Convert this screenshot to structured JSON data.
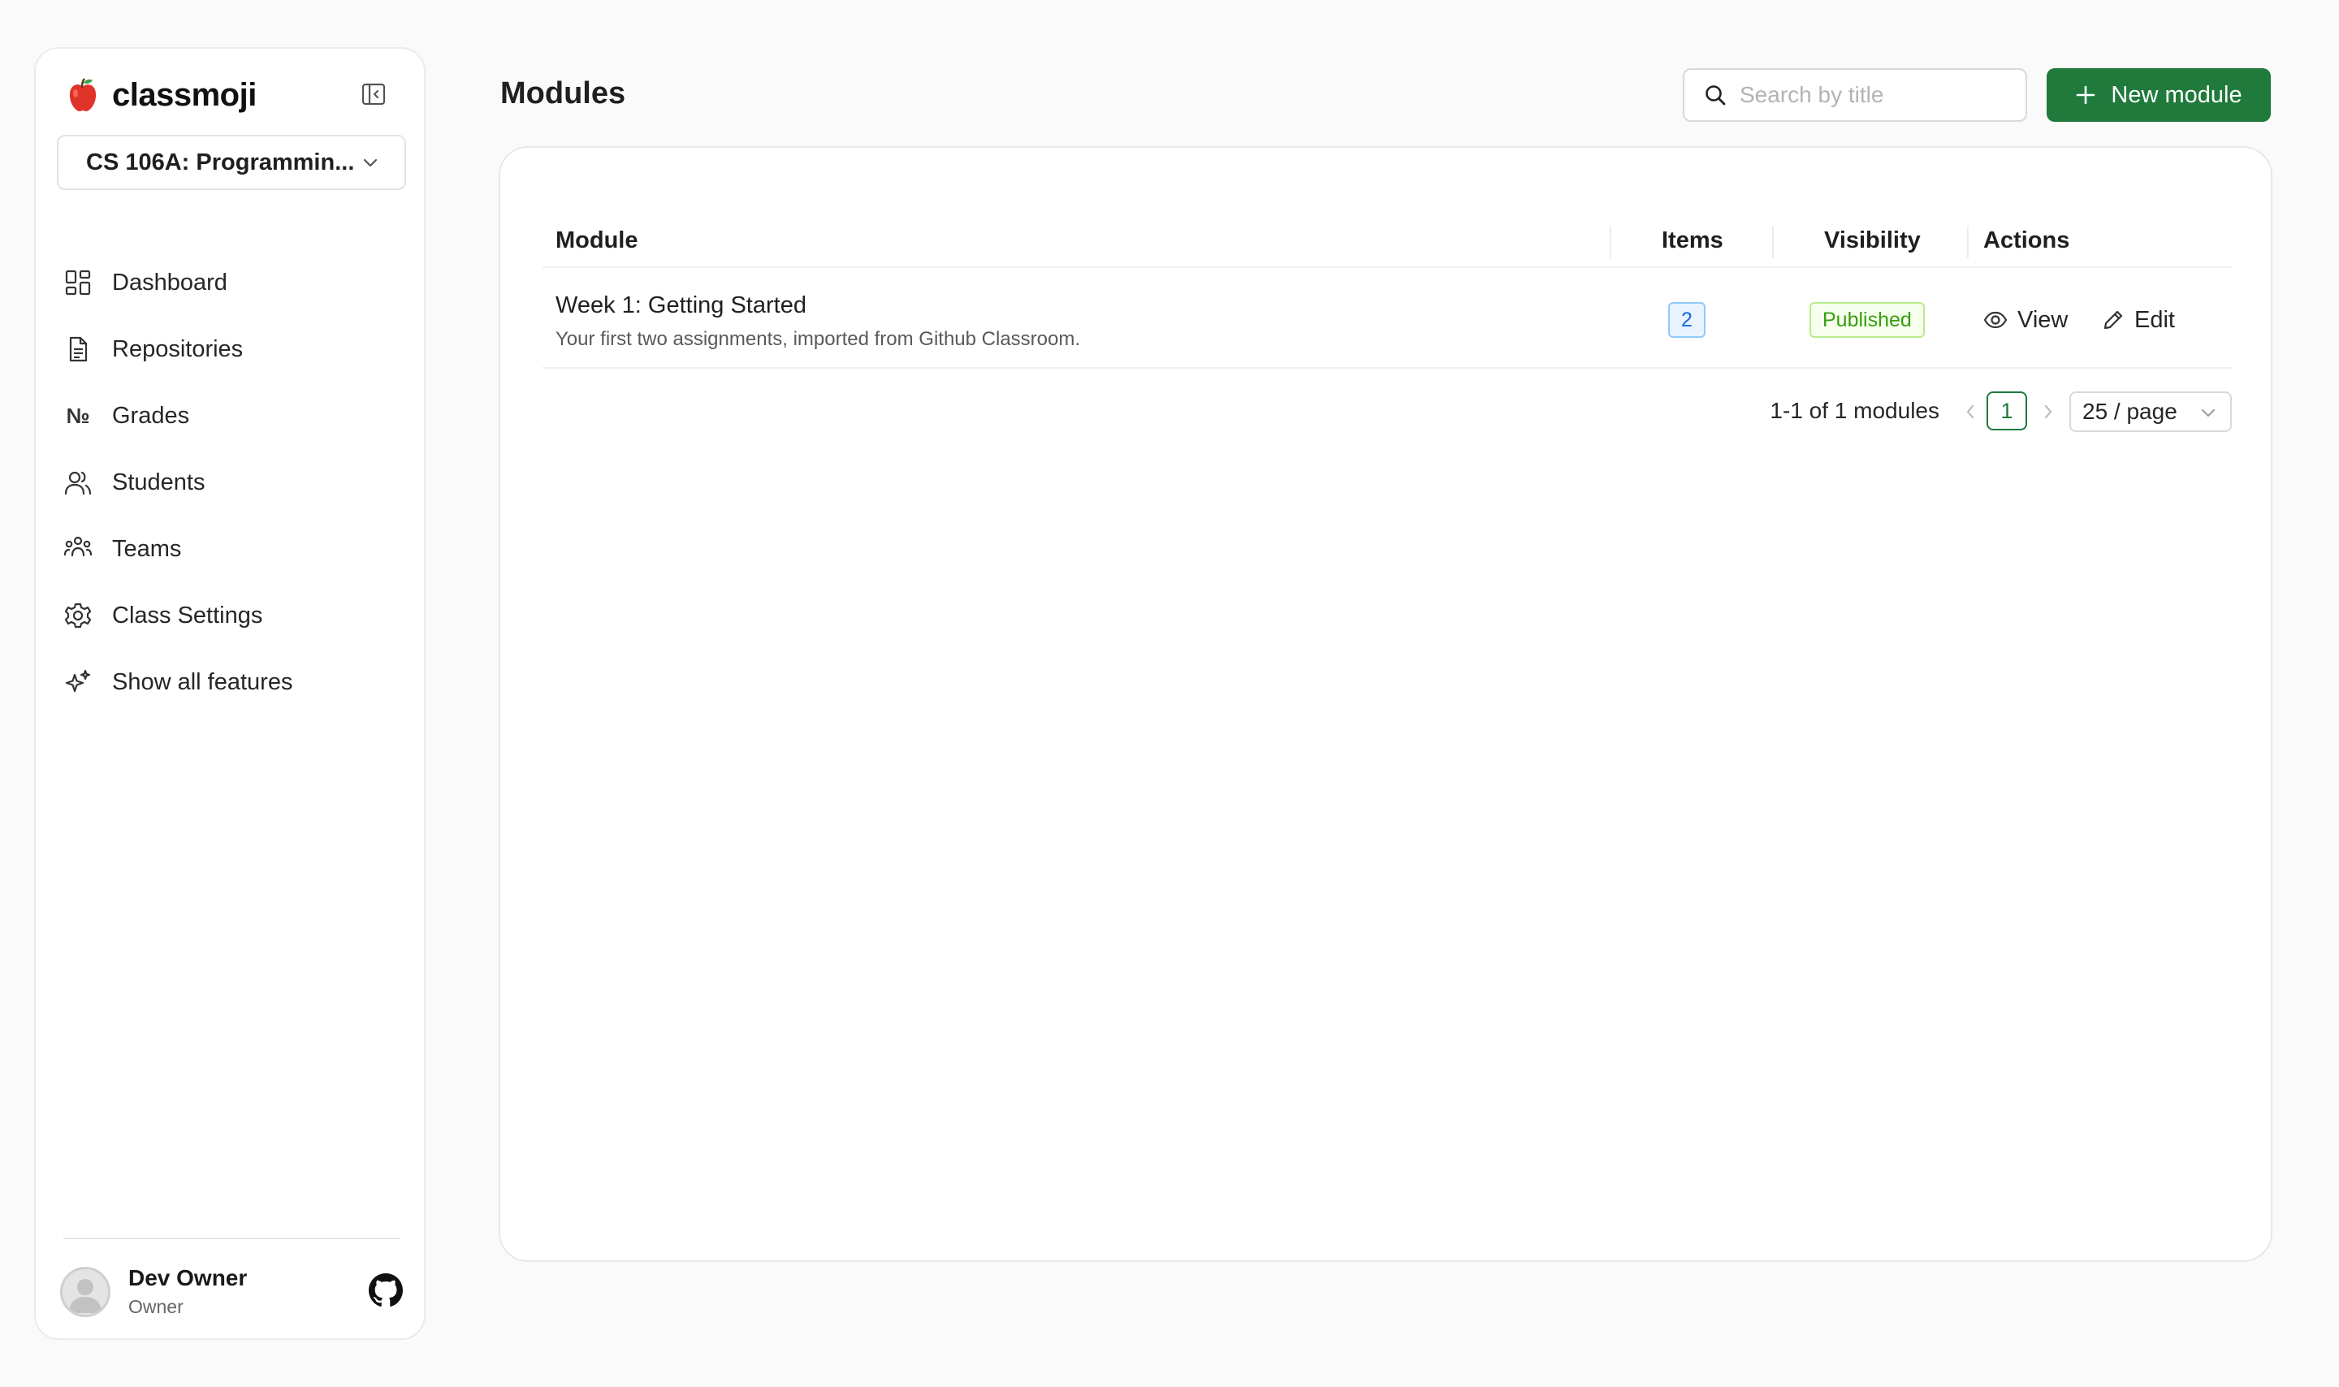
{
  "sidebar": {
    "brand": "classmoji",
    "class_selector": "CS 106A: Programmin...",
    "items": [
      {
        "label": "Dashboard",
        "icon": "dashboard-icon"
      },
      {
        "label": "Repositories",
        "icon": "document-icon"
      },
      {
        "label": "Grades",
        "icon": "numero-icon"
      },
      {
        "label": "Students",
        "icon": "users-icon"
      },
      {
        "label": "Teams",
        "icon": "team-icon"
      },
      {
        "label": "Class Settings",
        "icon": "gear-icon"
      },
      {
        "label": "Show all features",
        "icon": "sparkle-icon"
      }
    ],
    "user": {
      "name": "Dev Owner",
      "role": "Owner"
    }
  },
  "header": {
    "title": "Modules",
    "search_placeholder": "Search by title",
    "new_button": "New module"
  },
  "table": {
    "columns": [
      "Module",
      "Items",
      "Visibility",
      "Actions"
    ],
    "rows": [
      {
        "title": "Week 1: Getting Started",
        "description": "Your first two assignments, imported from Github Classroom.",
        "items": "2",
        "visibility": "Published",
        "actions": [
          "View",
          "Edit"
        ]
      }
    ]
  },
  "pagination": {
    "total_text": "1-1 of 1 modules",
    "current_page": "1",
    "page_size": "25 / page"
  },
  "colors": {
    "primary": "#1f7a3c",
    "items_badge": "#1668dc",
    "published_badge": "#389e0d"
  }
}
